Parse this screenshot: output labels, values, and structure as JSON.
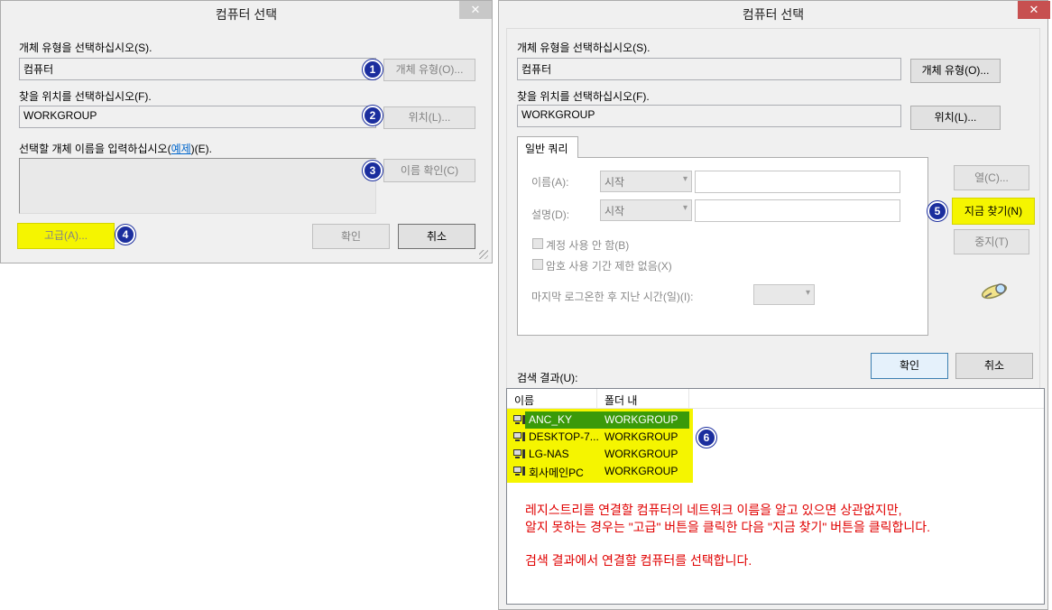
{
  "left_dialog": {
    "title": "컴퓨터 선택",
    "close_label": "✕",
    "object_type_label": "개체 유형을 선택하십시오(S).",
    "object_type_value": "컴퓨터",
    "object_type_button": "개체 유형(O)...",
    "location_label": "찾을 위치를 선택하십시오(F).",
    "location_value": "WORKGROUP",
    "location_button": "위치(L)...",
    "enter_names_label_prefix": "선택할 개체 이름을 입력하십시오(",
    "enter_names_link": "예제",
    "enter_names_label_suffix": ")(E).",
    "check_names_button": "이름 확인(C)",
    "advanced_button": "고급(A)...",
    "ok_button": "확인",
    "cancel_button": "취소"
  },
  "right_dialog": {
    "title": "컴퓨터 선택",
    "close_label": "✕",
    "object_type_label": "개체 유형을 선택하십시오(S).",
    "object_type_value": "컴퓨터",
    "object_type_button": "개체 유형(O)...",
    "location_label": "찾을 위치를 선택하십시오(F).",
    "location_value": "WORKGROUP",
    "location_button": "위치(L)...",
    "tab_label": "일반 쿼리",
    "name_label": "이름(A):",
    "name_combo": "시작",
    "desc_label": "설명(D):",
    "desc_combo": "시작",
    "disabled_accounts_label": "계정 사용 안 함(B)",
    "non_expiring_label": "암호 사용 기간 제한 없음(X)",
    "days_since_logon_label": "마지막 로그온한 후 지난 시간(일)(I):",
    "columns_button": "열(C)...",
    "find_now_button": "지금 찾기(N)",
    "stop_button": "중지(T)",
    "ok_button": "확인",
    "cancel_button": "취소",
    "results_label": "검색 결과(U):",
    "columns": [
      "이름",
      "폴더 내"
    ],
    "results": [
      {
        "name": "ANC_KY",
        "folder": "WORKGROUP",
        "selected": true
      },
      {
        "name": "DESKTOP-7...",
        "folder": "WORKGROUP",
        "selected": false
      },
      {
        "name": "LG-NAS",
        "folder": "WORKGROUP",
        "selected": false
      },
      {
        "name": "회사메인PC",
        "folder": "WORKGROUP",
        "selected": false
      }
    ],
    "note_lines": [
      "레지스트리를 연결할 컴퓨터의 네트워크 이름을 알고 있으면 상관없지만,",
      "알지 못하는 경우는 \"고급\" 버튼을 클릭한 다음  \"지금 찾기\" 버튼을 클릭합니다.",
      "검색 결과에서 연결할 컴퓨터를 선택합니다."
    ]
  },
  "badges": [
    "1",
    "2",
    "3",
    "4",
    "5",
    "6"
  ],
  "colors": {
    "highlight": "#f5f500",
    "badge": "#1b2e9e",
    "close": "#c75050",
    "selected_row": "#3a9a0a",
    "note": "#e00000"
  }
}
